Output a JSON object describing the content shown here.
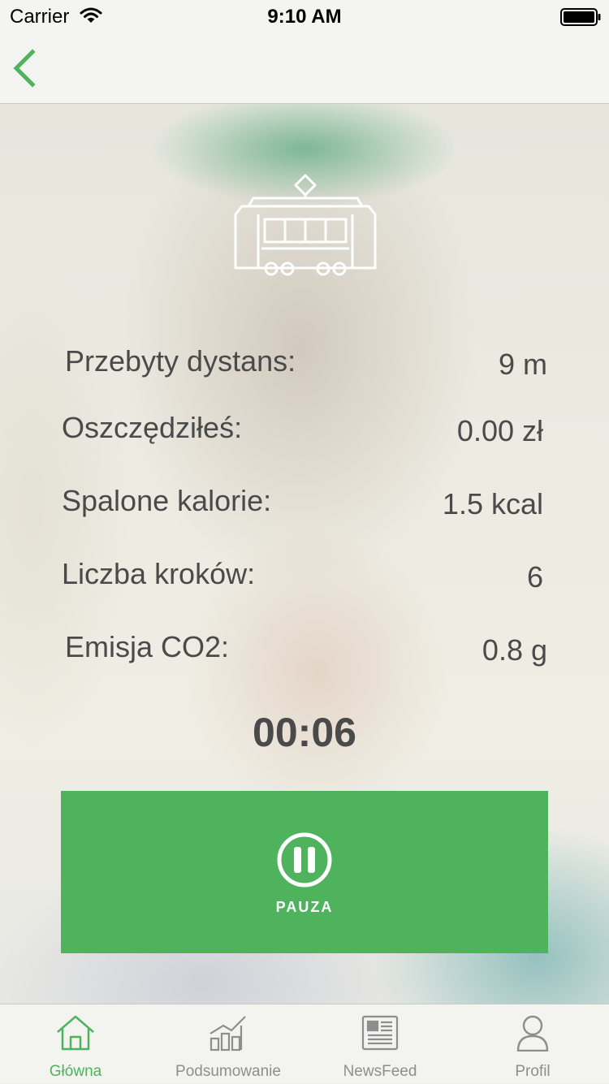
{
  "status_bar": {
    "carrier": "Carrier",
    "time": "9:10 AM"
  },
  "nav": {
    "back_icon": "chevron-left-icon"
  },
  "transport_icon": "tram-icon",
  "stats": [
    {
      "label": "Przebyty dystans:",
      "value": "9 m"
    },
    {
      "label": "Oszczędziłeś:",
      "value": "0.00 zł"
    },
    {
      "label": "Spalone kalorie:",
      "value": "1.5 kcal"
    },
    {
      "label": "Liczba kroków:",
      "value": "6"
    },
    {
      "label": "Emisja CO2:",
      "value": "0.8 g"
    }
  ],
  "timer": "00:06",
  "pause_button": {
    "label": "PAUZA",
    "icon": "pause-icon"
  },
  "tabs": [
    {
      "label": "Główna",
      "icon": "home-icon",
      "active": true
    },
    {
      "label": "Podsumowanie",
      "icon": "bar-chart-icon",
      "active": false
    },
    {
      "label": "NewsFeed",
      "icon": "newspaper-icon",
      "active": false
    },
    {
      "label": "Profil",
      "icon": "user-icon",
      "active": false
    }
  ],
  "colors": {
    "accent": "#4fb25c",
    "text": "#4a4a4a",
    "tab_inactive": "#8e8e8e"
  }
}
